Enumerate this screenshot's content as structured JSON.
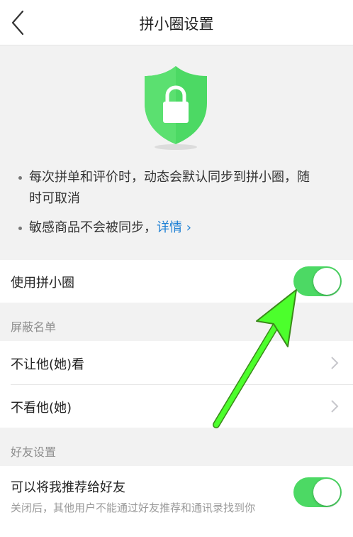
{
  "nav": {
    "title": "拼小圈设置"
  },
  "info": {
    "bullet1": "每次拼单和评价时，动态会默认同步到拼小圈，随时可取消",
    "bullet2": "敏感商品不会被同步，",
    "details_link": "详情 ›"
  },
  "settings": {
    "use_pinxiaoquan": {
      "label": "使用拼小圈",
      "enabled": true
    },
    "block_section": "屏蔽名单",
    "hide_from": "不让他(她)看",
    "not_see": "不看他(她)",
    "friend_section": "好友设置",
    "recommend": {
      "label": "可以将我推荐给好友",
      "desc": "关闭后，其他用户不能通过好友推荐和通讯录找到你",
      "enabled": true
    }
  },
  "colors": {
    "toggle_on": "#4cd964",
    "link": "#1b7fd4",
    "shield": "#4cd964",
    "annotation_arrow": "#4cff2c"
  },
  "icons": [
    "back-arrow-icon",
    "shield-lock-icon",
    "chevron-right-icon"
  ]
}
